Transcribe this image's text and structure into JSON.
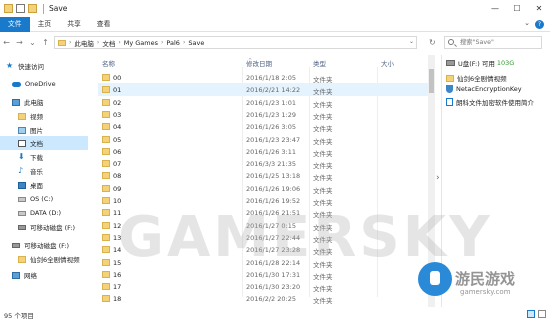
{
  "window": {
    "title": "Save",
    "controls": {
      "minimize": "—",
      "maximize": "☐",
      "close": "✕"
    }
  },
  "ribbon": {
    "tabs": [
      "文件",
      "主页",
      "共享",
      "查看"
    ],
    "help": "?"
  },
  "address": {
    "crumbs": [
      "此电脑",
      "文档",
      "My Games",
      "Pal6",
      "Save"
    ],
    "search_placeholder": "搜索\"Save\""
  },
  "sidebar": {
    "items": [
      {
        "label": "快速访问",
        "icon": "star-icon"
      },
      {
        "label": "OneDrive",
        "icon": "cloud-icon"
      },
      {
        "label": "此电脑",
        "icon": "computer-icon"
      },
      {
        "label": "视频",
        "icon": "video-icon"
      },
      {
        "label": "图片",
        "icon": "pictures-icon"
      },
      {
        "label": "文档",
        "icon": "documents-icon"
      },
      {
        "label": "下载",
        "icon": "download-icon"
      },
      {
        "label": "音乐",
        "icon": "music-icon"
      },
      {
        "label": "桌面",
        "icon": "desktop-icon"
      },
      {
        "label": "OS (C:)",
        "icon": "drive-icon"
      },
      {
        "label": "DATA (D:)",
        "icon": "drive-icon"
      },
      {
        "label": "可移动磁盘 (F:)",
        "icon": "usb-icon"
      },
      {
        "label": "可移动磁盘 (F:)",
        "icon": "usb-icon"
      },
      {
        "label": "仙剑6全剧情视频",
        "icon": "folder-icon"
      },
      {
        "label": "网络",
        "icon": "network-icon"
      }
    ]
  },
  "columns": {
    "name": "名称",
    "date": "修改日期",
    "type": "类型",
    "size": "大小"
  },
  "files": [
    {
      "name": "00",
      "date": "2016/1/18 2:05",
      "type": "文件夹"
    },
    {
      "name": "01",
      "date": "2016/2/21 14:22",
      "type": "文件夹"
    },
    {
      "name": "02",
      "date": "2016/1/23 1:01",
      "type": "文件夹"
    },
    {
      "name": "03",
      "date": "2016/1/23 1:29",
      "type": "文件夹"
    },
    {
      "name": "04",
      "date": "2016/1/26 3:05",
      "type": "文件夹"
    },
    {
      "name": "05",
      "date": "2016/1/23 23:47",
      "type": "文件夹"
    },
    {
      "name": "06",
      "date": "2016/1/26 3:11",
      "type": "文件夹"
    },
    {
      "name": "07",
      "date": "2016/3/3 21:35",
      "type": "文件夹"
    },
    {
      "name": "08",
      "date": "2016/1/25 13:18",
      "type": "文件夹"
    },
    {
      "name": "09",
      "date": "2016/1/26 19:06",
      "type": "文件夹"
    },
    {
      "name": "10",
      "date": "2016/1/26 19:52",
      "type": "文件夹"
    },
    {
      "name": "11",
      "date": "2016/1/26 21:51",
      "type": "文件夹"
    },
    {
      "name": "12",
      "date": "2016/1/27 0:15",
      "type": "文件夹"
    },
    {
      "name": "13",
      "date": "2016/1/27 22:44",
      "type": "文件夹"
    },
    {
      "name": "14",
      "date": "2016/1/27 23:28",
      "type": "文件夹"
    },
    {
      "name": "15",
      "date": "2016/1/28 22:14",
      "type": "文件夹"
    },
    {
      "name": "16",
      "date": "2016/1/30 17:31",
      "type": "文件夹"
    },
    {
      "name": "17",
      "date": "2016/1/30 23:20",
      "type": "文件夹"
    },
    {
      "name": "18",
      "date": "2016/2/2 20:25",
      "type": "文件夹"
    }
  ],
  "pane": {
    "drive_label": "U盘(F:) 可用",
    "free_space": "103G",
    "items": [
      "仙剑6全剧情视频",
      "NetacEncryptionKey",
      "朗科文件加密软件使用简介"
    ]
  },
  "status": {
    "count": "95 个项目"
  },
  "watermark": {
    "text": "GAMERSKY",
    "cn": "游民游戏",
    "url": "gamersky.com"
  }
}
